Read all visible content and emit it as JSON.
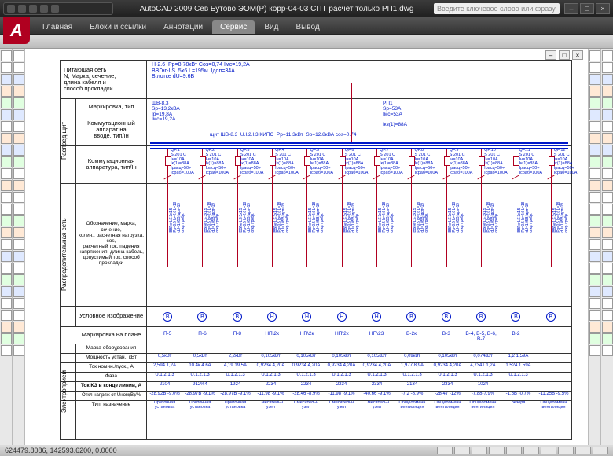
{
  "title": "AutoCAD 2009  Сев Бутово ЭОМ(Р) корр-04-03 СПТ расчет только РП1.dwg",
  "search_placeholder": "Введите ключевое слово или фразу",
  "winbtns": {
    "min": "–",
    "max": "□",
    "close": "×"
  },
  "logo": "A",
  "tabs": [
    "Главная",
    "Блоки и ссылки",
    "Аннотации",
    "Сервис",
    "Вид",
    "Вывод"
  ],
  "active_tab_index": 3,
  "status_coords": "624479.8086, 142593.6200, 0.0000",
  "stub": {
    "feed_header": "Питающая сеть\nN, Марка, сечение,\nдлина кабеля и\nспособ прокладки",
    "v1": "Распред\nщит",
    "v2": "Распределительная\nсеть",
    "v3": "Электроприем",
    "r_mark": "Маркировка, тип",
    "r_kom_vvod": "Коммутационный\nаппарат на\nвводе, тип/Iн",
    "r_kom_app": "Коммутационная\nаппаратура, тип/Iн",
    "r_cable": "Обозначение, марка, сечение,\nколич., расчетная нагрузка, cos,\nрасчетный ток, падения\nнапряжения, длина кабель,\nдопустимый ток, способ\nпрокладки",
    "r_sym": "Условное изображение",
    "r_plan": "Маркировка на плане",
    "r_eq": "Марка оборудования",
    "r_pwr": "Мощность устан., кВт",
    "r_cur": "Ток номин./пуск., А",
    "r_phase": "Фаза",
    "r_kz": "Ток КЗ в конце линии, А",
    "r_du": "Откл напряж от Uном(В)/%",
    "r_type": "Тип, назначение"
  },
  "feed_block": "Н-2.6  Pp=8,78кВт Cos=0,74 Iмс=19,2А\nВВГнг-LS  5х6 L=195м  Iдоп=34А\nВ лотке dU=9.6В",
  "incomer_left": "ШВ-8.3\nSр=13,2кВА\nIр=19,8А\nIмс=19,2А",
  "incomer_right": "РП1\nSр=53А\nIмс=53А\n\nIкз(1)=88А",
  "incomer_center": "щит ШВ-8.3  U.I.2.I.3.КИПС  Pр=11.3кВт  Sр=12.8кВА cos=0.74",
  "breaker_generic": "QF\nS 201 C\nIн=10А\nIк(1)=88А\nIрасц=50÷\nIсраб=100А",
  "cable_generic": "ВВГнг-LS 3х1.5\nPр=0.5 Iр=2.6 L=18\ndU=1.05В Iдоп=19\nоткр. пробр.",
  "columns": [
    {
      "sym": "В",
      "mark": "П-5",
      "pwr": "0,5кВт",
      "cur": "2,594 1,2А",
      "ph": "U.1.2.1.3",
      "kz": "2104",
      "du": "-28,92В -9,0%",
      "type": "Приточная\nустановка"
    },
    {
      "sym": "В",
      "mark": "П-6",
      "pwr": "0,5кВт",
      "cur": "10.4к 4.6А",
      "ph": "U.1.2.1.3",
      "kz": "912%4",
      "du": "-28,97В -9,1%",
      "type": "Приточная\nустановка"
    },
    {
      "sym": "В",
      "mark": "П-8",
      "pwr": "2,2кВт",
      "cur": "4,19 19,5А",
      "ph": "U.1.2.1.3",
      "kz": "1924",
      "du": "-28,97В -9,1%",
      "type": "Приточная\nустановка"
    },
    {
      "sym": "Н",
      "mark": "НП\\2к",
      "pwr": "0,105кВт",
      "cur": "0,9234 4,20А",
      "ph": "U.1.2.1.3",
      "kz": "2234",
      "du": "-11,98 -9,1%",
      "type": "Смесительн\nузел"
    },
    {
      "sym": "Н",
      "mark": "НП\\2к",
      "pwr": "0,105кВт",
      "cur": "0,9234 4,20А",
      "ph": "U.1.2.1.3",
      "kz": "2234",
      "du": "-28,46 -8,9%",
      "type": "Смесительн\nузел"
    },
    {
      "sym": "Н",
      "mark": "НП\\2к",
      "pwr": "0,105кВт",
      "cur": "0,9234 4,20А",
      "ph": "U.1.2.1.3",
      "kz": "2234",
      "du": "-11,98 -9,1%",
      "type": "Смесительн\nузел"
    },
    {
      "sym": "Н",
      "mark": "НП\\23",
      "pwr": "0,105кВт",
      "cur": "0,9234 4,20А",
      "ph": "U.1.2.1.3",
      "kz": "2334",
      "du": "-40,66 -9,1%",
      "type": "Смесительн\nузел"
    },
    {
      "sym": "В",
      "mark": "В-2к",
      "pwr": "0,09кВт",
      "cur": "1,977 8,9А",
      "ph": "U.1.2.1.3",
      "kz": "2134",
      "du": "-7,2 -8,9%",
      "type": "Общеобменн\nвентиляция"
    },
    {
      "sym": "В",
      "mark": "В-3",
      "pwr": "0,105кВт",
      "cur": "0,9234 4,20А",
      "ph": "U.1.2.1.3",
      "kz": "2334",
      "du": "-28,47 -12%",
      "type": "Общеобменн\nвентиляция"
    },
    {
      "sym": "В",
      "mark": "В-4, В-5, В-6, В-7",
      "pwr": "0,074кВт",
      "cur": "4,7341 1,2А",
      "ph": "U.1.2.1.3",
      "kz": "1024",
      "du": "-7,88-7,9%",
      "type": "Общеобменн\nвентиляция"
    },
    {
      "sym": "В",
      "mark": "В-2",
      "pwr": "1,2 1,59А",
      "cur": "1.524 1.59А",
      "ph": "U.1.2.1.3",
      "kz": "",
      "du": "-1.5В -0.7%",
      "type": "резерв"
    },
    {
      "sym": "В",
      "mark": "",
      "pwr": "",
      "cur": "",
      "ph": "",
      "kz": "",
      "du": "-11,25В -9.5%",
      "type": "Общеобменн\nвентиляция"
    }
  ]
}
